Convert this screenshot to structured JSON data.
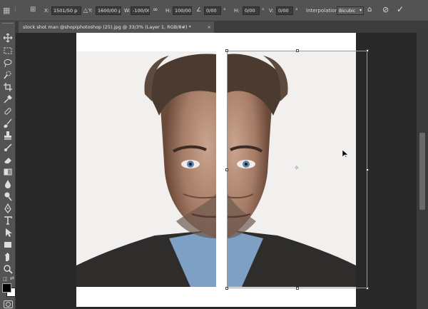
{
  "options_bar": {
    "x_label": "X:",
    "x_value": "1501/50 p",
    "y_label": "Y:",
    "y_value": "1600/00 p",
    "w_label": "W:",
    "w_value": "-100/00%",
    "h_label": "H:",
    "h_value": "100/00%",
    "rotate_value": "0/00",
    "hskew_label": "H:",
    "hskew_value": "0/00",
    "vskew_label": "V:",
    "vskew_value": "0/00",
    "interpolation_label": "Interpolation:",
    "interpolation_value": "Bicubic"
  },
  "document": {
    "tab_title": "stock shot man @shopiphotoshop (25).jpg @ 33/3% (Layer 1, RGB/8#) *",
    "close_glyph": "×"
  },
  "colors": {
    "panel": "#535353",
    "workspace": "#282828",
    "canvas": "#ffffff"
  },
  "icons": {
    "tools": [
      "move-icon",
      "marquee-icon",
      "lasso-icon",
      "quick-select-icon",
      "crop-icon",
      "eyedropper-icon",
      "healing-brush-icon",
      "brush-icon",
      "clone-stamp-icon",
      "history-brush-icon",
      "eraser-icon",
      "gradient-icon",
      "blur-icon",
      "dodge-icon",
      "pen-icon",
      "type-icon",
      "path-select-icon",
      "rectangle-icon",
      "hand-icon",
      "zoom-icon"
    ]
  }
}
